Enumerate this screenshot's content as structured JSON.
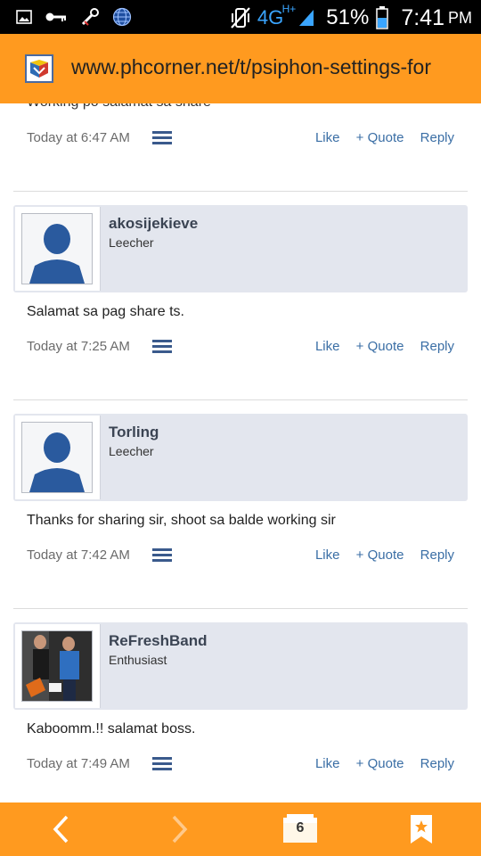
{
  "status_bar": {
    "network_type": "4G",
    "network_sub": "H+",
    "battery": "51%",
    "time": "7:41",
    "ampm": "PM",
    "icons": [
      "image-icon",
      "key-icon",
      "tools-icon",
      "globe-icon",
      "vibrate-icon",
      "signal-icon",
      "battery-icon"
    ]
  },
  "url_bar": {
    "url": "www.phcorner.net/t/psiphon-settings-for",
    "site_icon": "phcorner-favicon"
  },
  "feed": {
    "partial_message": "Working po salamat sa share",
    "first_footer": {
      "time": "Today at 6:47 AM",
      "like": "Like",
      "quote": "+ Quote",
      "reply": "Reply"
    },
    "posts": [
      {
        "username": "akosijekieve",
        "user_title": "Leecher",
        "message": "Salamat sa pag share ts.",
        "time": "Today at 7:25 AM",
        "like": "Like",
        "quote": "+ Quote",
        "reply": "Reply"
      },
      {
        "username": "Torling",
        "user_title": "Leecher",
        "message": "Thanks for sharing sir, shoot sa balde working sir",
        "time": "Today at 7:42 AM",
        "like": "Like",
        "quote": "+ Quote",
        "reply": "Reply"
      },
      {
        "username": "ReFreshBand",
        "user_title": "Enthusiast",
        "message": "Kaboomm.!! salamat boss.",
        "time": "Today at 7:49 AM",
        "like": "Like",
        "quote": "+ Quote",
        "reply": "Reply"
      }
    ]
  },
  "bottom_nav": {
    "tab_count": "6",
    "icons": [
      "back-icon",
      "forward-icon",
      "tabs-icon",
      "bookmark-icon"
    ]
  },
  "colors": {
    "accent": "#ff9a1f",
    "link": "#3a6ea5",
    "user_box": "#e3e6ee"
  }
}
